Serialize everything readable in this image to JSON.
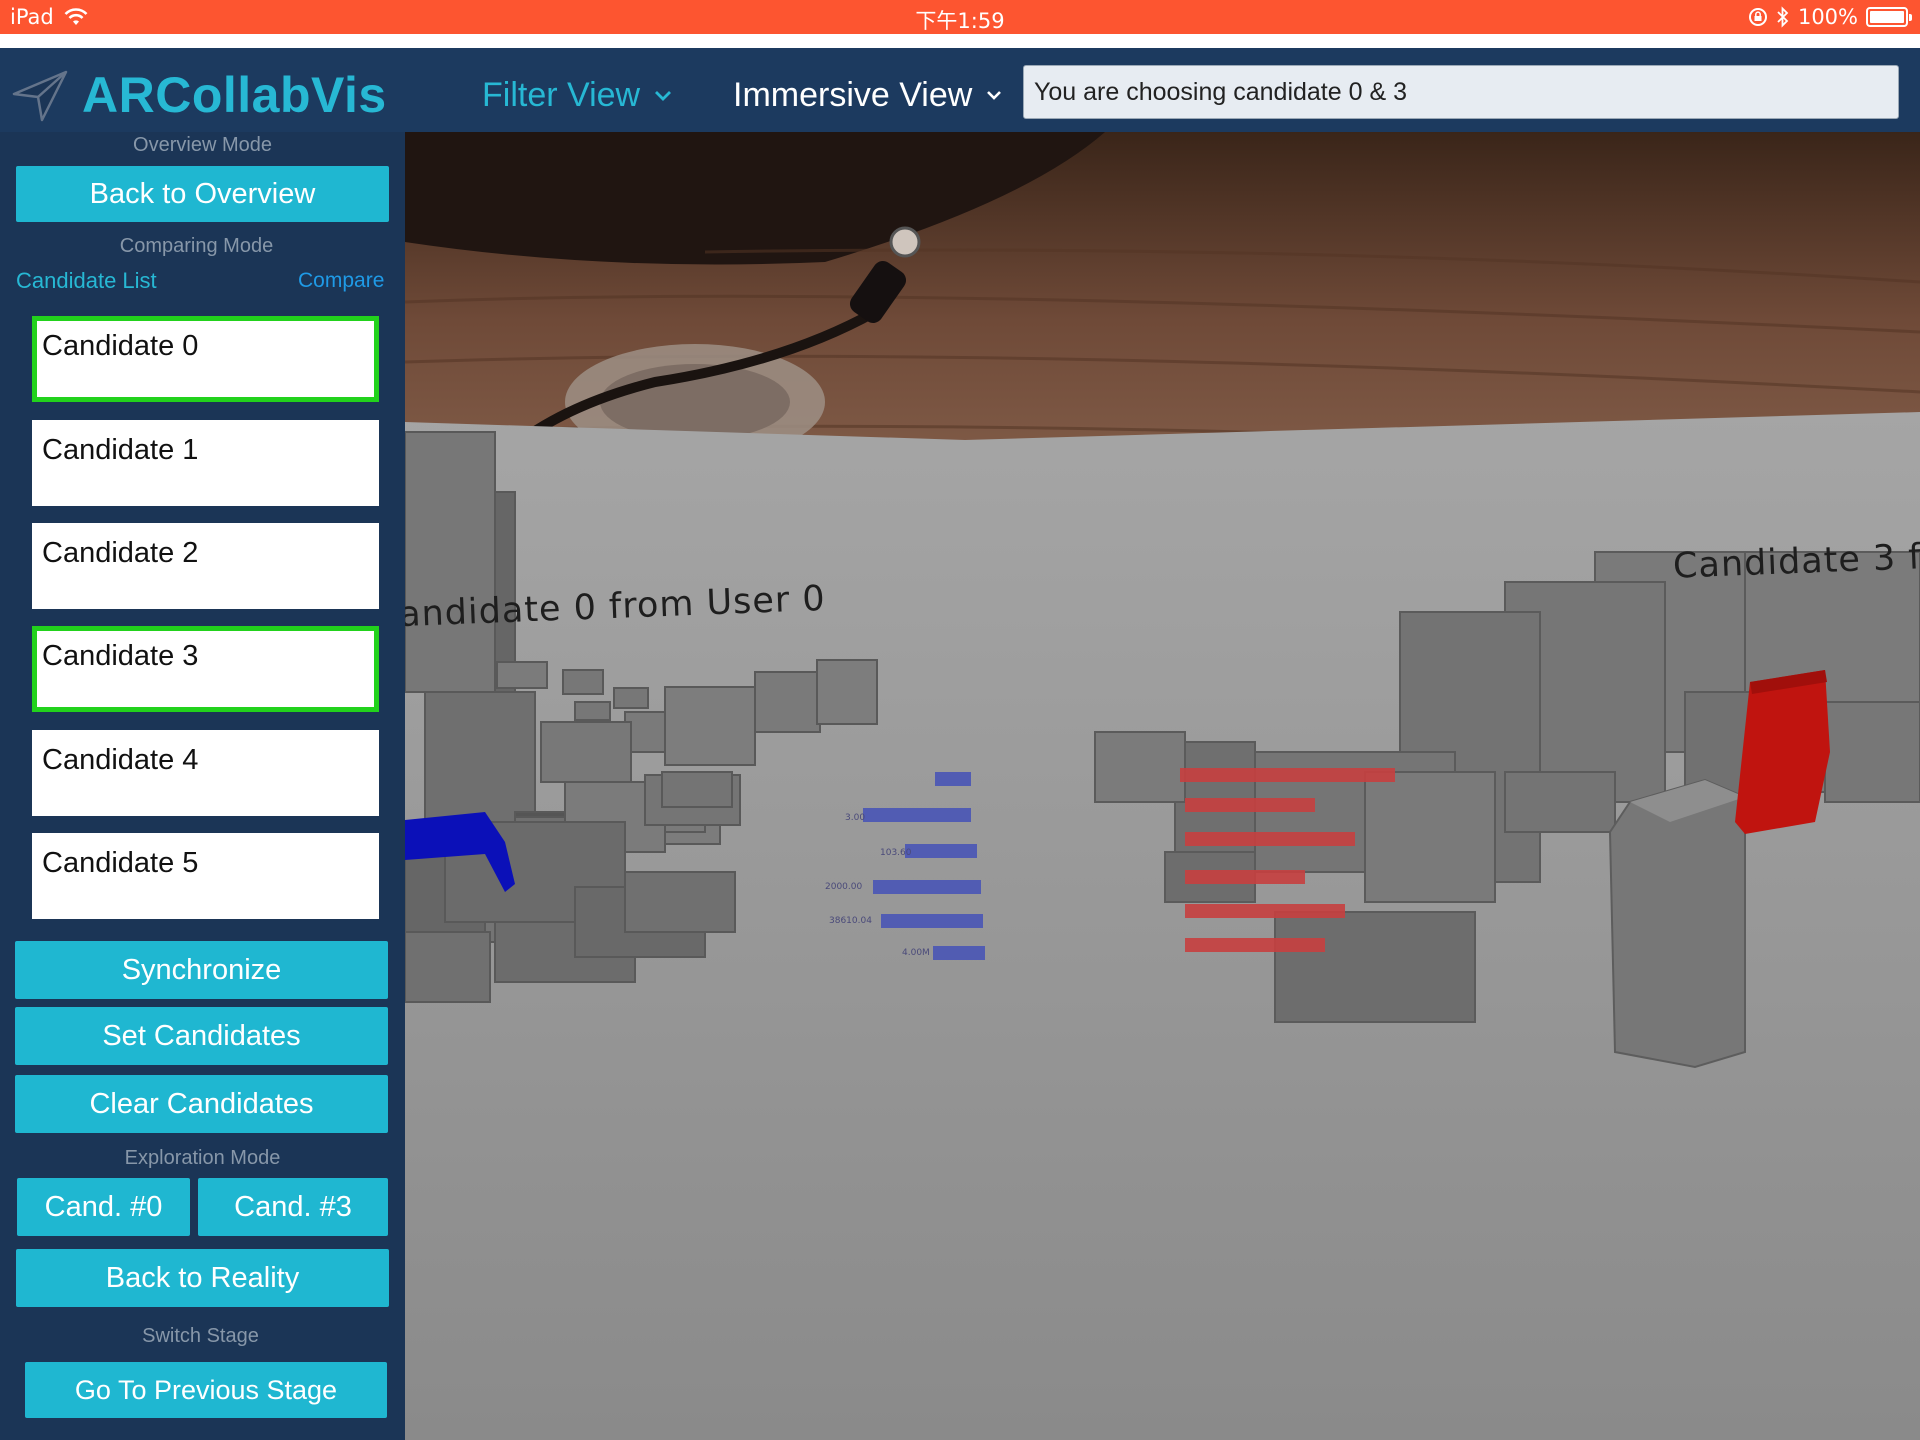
{
  "status_bar": {
    "device": "iPad",
    "time": "下午1:59",
    "battery": "100%"
  },
  "header": {
    "app_title": "ARCollabVis",
    "filter_view": "Filter View",
    "immersive_view": "Immersive View",
    "status_text": "You are choosing candidate 0 & 3"
  },
  "sidebar": {
    "overview_mode_label": "Overview Mode",
    "back_to_overview": "Back to Overview",
    "comparing_mode_label": "Comparing Mode",
    "candidate_list_label": "Candidate List",
    "compare": "Compare",
    "candidates": [
      {
        "label": "Candidate 0",
        "selected": true
      },
      {
        "label": "Candidate 1",
        "selected": false
      },
      {
        "label": "Candidate 2",
        "selected": false
      },
      {
        "label": "Candidate 3",
        "selected": true
      },
      {
        "label": "Candidate 4",
        "selected": false
      },
      {
        "label": "Candidate 5",
        "selected": false
      }
    ],
    "synchronize": "Synchronize",
    "set_candidates": "Set Candidates",
    "clear_candidates": "Clear Candidates",
    "exploration_mode_label": "Exploration Mode",
    "cand_0": "Cand. #0",
    "cand_3": "Cand. #3",
    "back_to_reality": "Back to Reality",
    "switch_stage_label": "Switch Stage",
    "go_to_previous_stage": "Go To Previous Stage"
  },
  "ar_view": {
    "candidate_0_label": "andidate 0 from User 0",
    "candidate_3_label": "Candidate 3 f"
  },
  "colors": {
    "accent": "#1fb7d1",
    "status_bar": "#fd5530",
    "selected_border": "#22d21c",
    "candidate_0_highlight": "#0b10b8",
    "candidate_3_highlight": "#c0140f"
  }
}
